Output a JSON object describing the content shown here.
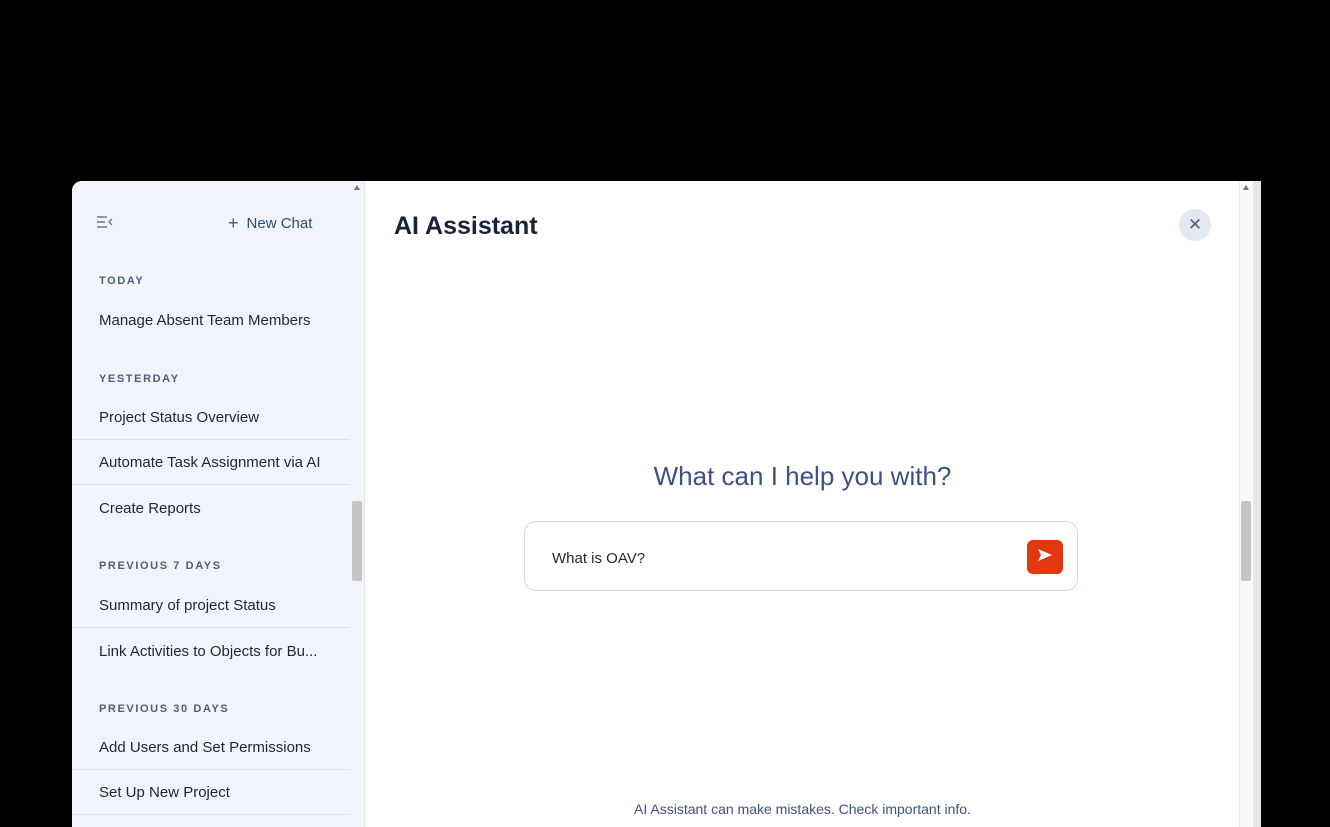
{
  "sidebar": {
    "new_chat_label": "New Chat",
    "sections": [
      {
        "label": "TODAY",
        "items": [
          "Manage Absent Team Members"
        ]
      },
      {
        "label": "YESTERDAY",
        "items": [
          "Project Status Overview",
          "Automate Task Assignment via AI",
          "Create Reports"
        ]
      },
      {
        "label": "PREVIOUS 7 DAYS",
        "items": [
          "Summary of project Status",
          "Link Activities to Objects for Bu..."
        ]
      },
      {
        "label": "PREVIOUS 30 DAYS",
        "items": [
          "Add Users and Set Permissions",
          "Set Up New Project"
        ]
      }
    ]
  },
  "main": {
    "title": "AI Assistant",
    "close_icon": "close-icon",
    "heading": "What can I help you with?",
    "input_value": "What is OAV?",
    "send_icon": "send-icon",
    "disclaimer": "AI Assistant can make mistakes. Check important info."
  },
  "colors": {
    "accent": "#e2380e",
    "sidebar_bg": "#f1f5fb",
    "heading": "#3f5182"
  }
}
